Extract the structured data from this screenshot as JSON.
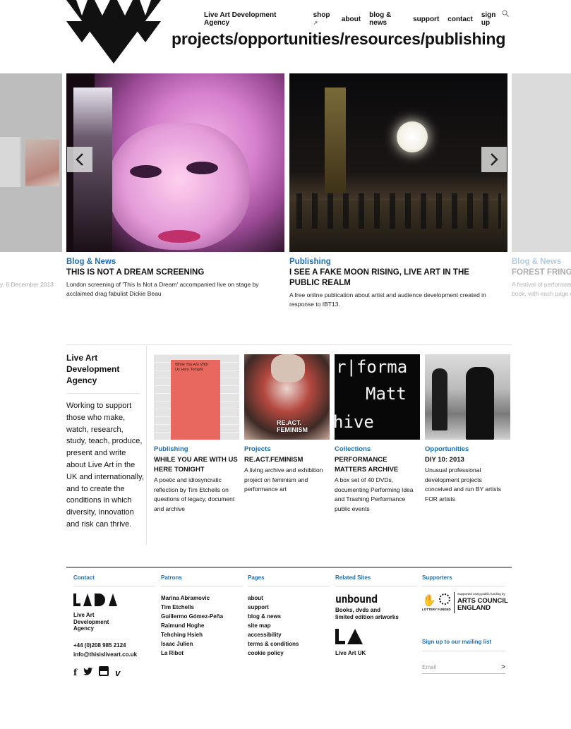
{
  "header": {
    "org_name": "Live Art Development Agency",
    "nav": [
      "shop",
      "about",
      "blog & news",
      "support",
      "contact",
      "sign up"
    ],
    "tagline": "projects/opportunities/resources/publishing"
  },
  "carousel": {
    "left_partial": {
      "date": "y, 6 December 2013"
    },
    "slides": [
      {
        "category": "Blog & News",
        "title": "THIS IS NOT A DREAM SCREENING",
        "description": "London screening of 'This Is Not a Dream' accompanied live on stage by acclaimed drag fabulist Dickie Beau"
      },
      {
        "category": "Publishing",
        "title": "I SEE A FAKE MOON RISING, LIVE ART IN THE PUBLIC REALM",
        "description": "A free online publication about artist and audience development created in response to IBT13."
      }
    ],
    "right_partial": {
      "category": "Blog & News",
      "title": "FOREST FRINGE,",
      "description_line1": "A festival of performan",
      "description_line2": "book, with each page o"
    }
  },
  "about": {
    "title": "Live Art Development Agency",
    "text": "Working to support those who make, watch, research, study, teach, produce, present and write about Live Art in the UK and internationally, and to create the conditions in which diversity, innovation and risk can thrive."
  },
  "features": [
    {
      "category": "Publishing",
      "title": "WHILE YOU ARE WITH US HERE TONIGHT",
      "description": "A poetic and idiosyncratic reflection by Tim Etchells on questions of legacy, document and archive",
      "image_text": "While You Are With Us Here Tonight"
    },
    {
      "category": "Projects",
      "title": "RE.ACT.FEMINISM",
      "description": "A living archive and exhibition project on feminism and performance art",
      "image_text": "RE.ACT. FEMINISM"
    },
    {
      "category": "Collections",
      "title": "PERFORMANCE MATTERS ARCHIVE",
      "description": "A box set of 40 DVDs, documenting Performing Idea and Trashing Performance public events",
      "image_lines": [
        "r|forma",
        "Matt",
        "hive"
      ]
    },
    {
      "category": "Opportunities",
      "title": "DIY 10: 2013",
      "description": "Unusual professional development projects conceived and run BY artists FOR artists"
    }
  ],
  "footer": {
    "contact": {
      "heading": "Contact",
      "logo_text": "LADA",
      "org_lines": [
        "Live Art",
        "Development",
        "Agency"
      ],
      "phone": "+44 (0)208 985 2124",
      "email": "info@thisisliveart.co.uk"
    },
    "patrons": {
      "heading": "Patrons",
      "items": [
        "Marina Abramovic",
        "Tim Etchells",
        "Guillermo Gómez-Peña",
        "Raimund Hoghe",
        "Tehching Hsieh",
        "Isaac Julien",
        "La Ribot"
      ]
    },
    "pages": {
      "heading": "Pages",
      "items": [
        "about",
        "support",
        "blog & news",
        "site map",
        "accessibility",
        "terms & conditions",
        "cookie policy"
      ]
    },
    "related": {
      "heading": "Related Sites",
      "unbound_logo": "unbound",
      "unbound_lines": [
        "Books, dvds and",
        "limited edition artworks"
      ],
      "liveartuk_logo": "LA",
      "liveartuk_label": "Live Art UK"
    },
    "supporters": {
      "heading": "Supporters",
      "ace_small": "Supported using public funding by",
      "ace_lines": [
        "ARTS COUNCIL",
        "ENGLAND"
      ],
      "lottery": "LOTTERY FUNDED",
      "mailing_heading": "Sign up to our mailing list",
      "email_placeholder": "Email",
      "submit": ">"
    }
  },
  "colors": {
    "accent": "#1f6fb3",
    "text": "#111111"
  }
}
